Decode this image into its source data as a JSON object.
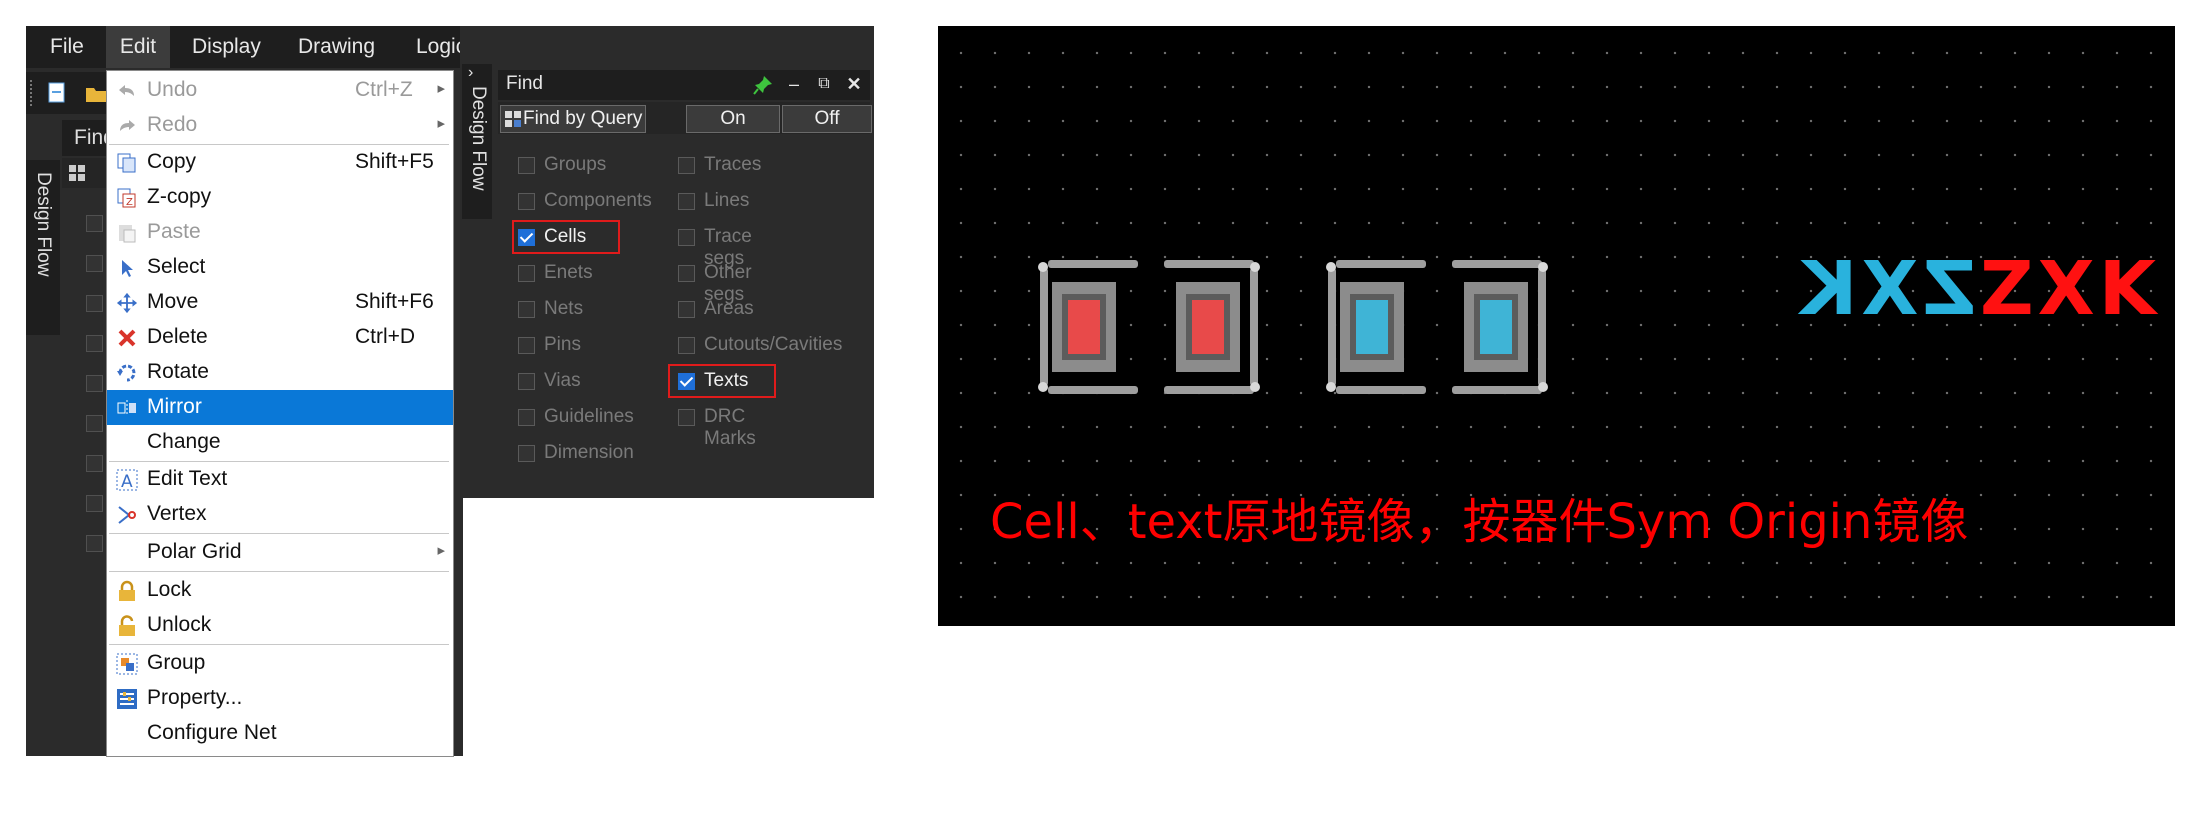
{
  "menubar": {
    "items": [
      "File",
      "Edit",
      "Display",
      "Drawing",
      "Logic"
    ]
  },
  "left_panel": {
    "find_tab": "Find",
    "design_flow": "Design Flow"
  },
  "edit_menu": {
    "items": [
      {
        "label": "Undo",
        "shortcut": "Ctrl+Z",
        "icon": "undo-icon",
        "disabled": true,
        "submenu": true
      },
      {
        "label": "Redo",
        "shortcut": "",
        "icon": "redo-icon",
        "disabled": true,
        "submenu": true
      },
      {
        "label": "Copy",
        "shortcut": "Shift+F5",
        "icon": "copy-icon"
      },
      {
        "label": "Z-copy",
        "shortcut": "",
        "icon": "z-copy-icon"
      },
      {
        "label": "Paste",
        "shortcut": "",
        "icon": "paste-icon",
        "disabled": true
      },
      {
        "label": "Select",
        "shortcut": "",
        "icon": "select-arrow-icon"
      },
      {
        "label": "Move",
        "shortcut": "Shift+F6",
        "icon": "move-icon"
      },
      {
        "label": "Delete",
        "shortcut": "Ctrl+D",
        "icon": "delete-icon"
      },
      {
        "label": "Rotate",
        "shortcut": "",
        "icon": "rotate-icon"
      },
      {
        "label": "Mirror",
        "shortcut": "",
        "icon": "mirror-icon",
        "selected": true
      },
      {
        "label": "Change",
        "shortcut": "",
        "icon": ""
      },
      {
        "label": "Edit Text",
        "shortcut": "",
        "icon": "edit-text-icon"
      },
      {
        "label": "Vertex",
        "shortcut": "",
        "icon": "vertex-icon"
      },
      {
        "label": "Polar Grid",
        "shortcut": "",
        "icon": "",
        "submenu": true
      },
      {
        "label": "Lock",
        "shortcut": "",
        "icon": "lock-icon"
      },
      {
        "label": "Unlock",
        "shortcut": "",
        "icon": "unlock-icon"
      },
      {
        "label": "Group",
        "shortcut": "",
        "icon": "group-icon"
      },
      {
        "label": "Property...",
        "shortcut": "",
        "icon": "property-icon"
      },
      {
        "label": "Configure Net",
        "shortcut": "",
        "icon": ""
      }
    ]
  },
  "find_panel": {
    "title": "Find",
    "design_flow": "Design Flow",
    "query_button": "Find by Query",
    "on_button": "On",
    "off_button": "Off",
    "left_column": [
      {
        "label": "Groups",
        "checked": false
      },
      {
        "label": "Components",
        "checked": false
      },
      {
        "label": "Cells",
        "checked": true
      },
      {
        "label": "Enets",
        "checked": false
      },
      {
        "label": "Nets",
        "checked": false
      },
      {
        "label": "Pins",
        "checked": false
      },
      {
        "label": "Vias",
        "checked": false
      },
      {
        "label": "Guidelines",
        "checked": false
      },
      {
        "label": "Dimension",
        "checked": false
      }
    ],
    "right_column": [
      {
        "label": "Traces",
        "checked": false
      },
      {
        "label": "Lines",
        "checked": false
      },
      {
        "label": "Trace segs",
        "checked": false
      },
      {
        "label": "Other segs",
        "checked": false
      },
      {
        "label": "Areas",
        "checked": false
      },
      {
        "label": "Cutouts/Cavities",
        "checked": false
      },
      {
        "label": "Texts",
        "checked": true
      },
      {
        "label": "DRC Marks",
        "checked": false
      }
    ]
  },
  "canvas": {
    "text_mirrored": "ZXK",
    "text_original": "ZXK",
    "caption": "Cell、text原地镜像，按器件Sym Origin镜像",
    "colors": {
      "background": "#000000",
      "pad_red": "#e84a4a",
      "pad_cyan": "#3fb4d6",
      "text_cyan": "#29b2dd",
      "text_red": "#ff1111",
      "caption": "#ff0000"
    }
  }
}
